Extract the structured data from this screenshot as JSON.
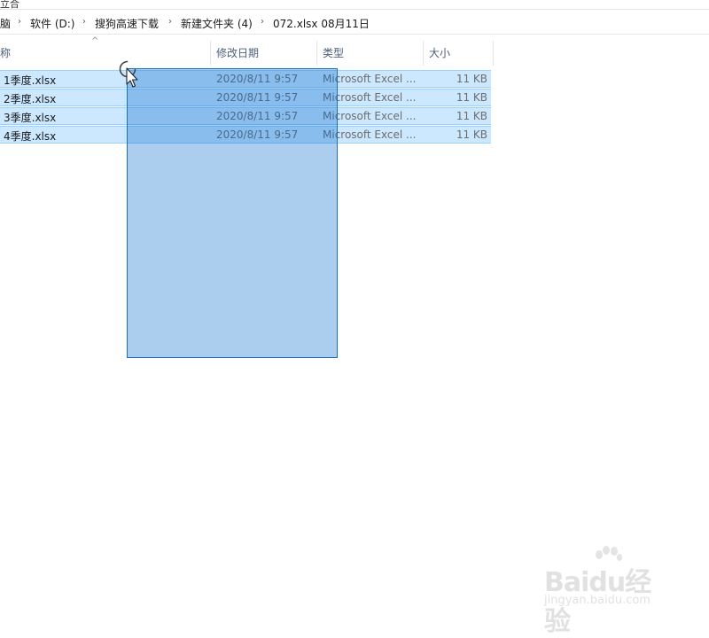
{
  "window": {
    "top_fragment": "立合"
  },
  "address_bar": {
    "crumbs": [
      "脑",
      "软件 (D:)",
      "搜狗高速下载",
      "新建文件夹 (4)",
      "072.xlsx 08月11日"
    ],
    "separator_icon": "chevron-right-icon"
  },
  "columns": {
    "name": "称",
    "modified": "修改日期",
    "type": "类型",
    "size": "大小",
    "sort_icon": "sort-up-icon"
  },
  "files": [
    {
      "name": "1季度.xlsx",
      "modified": "2020/8/11 9:57",
      "type": "Microsoft Excel ...",
      "size": "11 KB",
      "selected": true
    },
    {
      "name": "2季度.xlsx",
      "modified": "2020/8/11 9:57",
      "type": "Microsoft Excel ...",
      "size": "11 KB",
      "selected": true
    },
    {
      "name": "3季度.xlsx",
      "modified": "2020/8/11 9:57",
      "type": "Microsoft Excel ...",
      "size": "11 KB",
      "selected": true
    },
    {
      "name": "4季度.xlsx",
      "modified": "2020/8/11 9:57",
      "type": "Microsoft Excel ...",
      "size": "11 KB",
      "selected": true
    }
  ],
  "selection": {
    "marquee_color": "#0066cc",
    "row_highlight_color": "#cce8ff"
  },
  "cursor": {
    "icon": "busy-arrow-cursor-icon"
  },
  "watermark": {
    "main": "Baidu经验",
    "sub": "jingyan.baidu.com"
  }
}
